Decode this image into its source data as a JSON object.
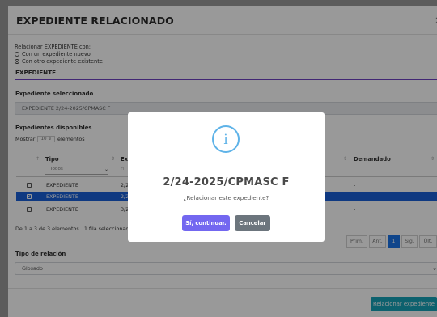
{
  "dialog": {
    "title": "EXPEDIENTE RELACIONADO",
    "close": "×"
  },
  "relate": {
    "label": "Relacionar EXPEDIENTE con:",
    "options": [
      "Con un expediente nuevo",
      "Con otro expediente existente"
    ],
    "selected_index": 1
  },
  "section_title": "EXPEDIENTE",
  "selected_file": {
    "label": "Expediente seleccionado",
    "value": "EXPEDIENTE 2/24-2025/CPMASC F"
  },
  "available": {
    "label": "Expedientes disponibles",
    "show_prefix": "Mostrar",
    "show_count": "10",
    "show_suffix": "elementos",
    "columns": [
      "Tipo",
      "Exp",
      "Demandado"
    ],
    "tipo_filter": "Todos",
    "exp_filter": "Fi",
    "rows": [
      {
        "tipo": "EXPEDIENTE",
        "exp": "2/2",
        "demandado": "-",
        "selected": false
      },
      {
        "tipo": "EXPEDIENTE",
        "exp": "2/2",
        "demandado": "-",
        "selected": true
      },
      {
        "tipo": "EXPEDIENTE",
        "exp": "3/2",
        "demandado": "-",
        "selected": false
      }
    ],
    "info": "De 1 a 3 de 3 elementos   1 fila seleccionada",
    "pagination": [
      "Prim.",
      "Ant.",
      "1",
      "Sig.",
      "Últ."
    ]
  },
  "relation_type": {
    "label": "Tipo de relación",
    "value": "Glosado"
  },
  "relate_button": "Relacionar expediente",
  "modal": {
    "icon": "i",
    "title": "2/24-2025/CPMASC F",
    "text": "¿Relacionar este expediente?",
    "confirm": "Sí, continuar.",
    "cancel": "Cancelar"
  },
  "colors": {
    "accent": "#6f42c1",
    "selected_row": "#1a5fd7",
    "confirm": "#7367f0",
    "cancel": "#6c757d",
    "relate_button": "#17a2b8",
    "info_icon": "#5fb3e8"
  }
}
